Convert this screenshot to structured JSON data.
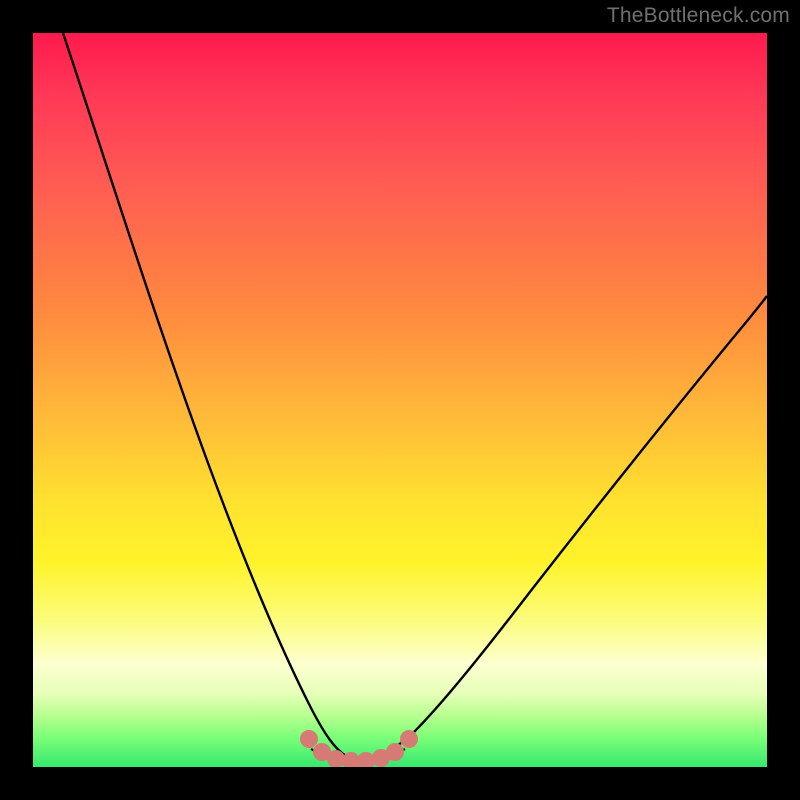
{
  "watermark": "TheBottleneck.com",
  "chart_data": {
    "type": "line",
    "title": "",
    "xlabel": "",
    "ylabel": "",
    "xlim": [
      0,
      100
    ],
    "ylim": [
      0,
      100
    ],
    "background_gradient": {
      "direction": "vertical",
      "stops": [
        {
          "pct": 0,
          "color": "#ff1a4d"
        },
        {
          "pct": 20,
          "color": "#ff5a53"
        },
        {
          "pct": 40,
          "color": "#ff9a3d"
        },
        {
          "pct": 60,
          "color": "#ffd82f"
        },
        {
          "pct": 80,
          "color": "#fdfe9a"
        },
        {
          "pct": 92,
          "color": "#c7ff93"
        },
        {
          "pct": 100,
          "color": "#36e86f"
        }
      ]
    },
    "series": [
      {
        "name": "bottleneck-curve",
        "stroke": "#000000",
        "points": [
          {
            "x": 5,
            "y": 100
          },
          {
            "x": 10,
            "y": 80
          },
          {
            "x": 15,
            "y": 62
          },
          {
            "x": 20,
            "y": 45
          },
          {
            "x": 25,
            "y": 30
          },
          {
            "x": 30,
            "y": 17
          },
          {
            "x": 35,
            "y": 7
          },
          {
            "x": 38,
            "y": 2
          },
          {
            "x": 40,
            "y": 0.5
          },
          {
            "x": 43,
            "y": 0
          },
          {
            "x": 47,
            "y": 0
          },
          {
            "x": 50,
            "y": 1
          },
          {
            "x": 55,
            "y": 7
          },
          {
            "x": 60,
            "y": 14
          },
          {
            "x": 70,
            "y": 28
          },
          {
            "x": 80,
            "y": 42
          },
          {
            "x": 90,
            "y": 55
          },
          {
            "x": 100,
            "y": 67
          }
        ]
      }
    ],
    "markers": {
      "name": "valley-highlight",
      "color": "#d57a74",
      "points": [
        {
          "x": 38,
          "y": 2
        },
        {
          "x": 40,
          "y": 0.6
        },
        {
          "x": 42,
          "y": 0.1
        },
        {
          "x": 44,
          "y": 0
        },
        {
          "x": 46,
          "y": 0.1
        },
        {
          "x": 48,
          "y": 0.6
        },
        {
          "x": 50,
          "y": 1.4
        },
        {
          "x": 52,
          "y": 3
        }
      ]
    }
  }
}
